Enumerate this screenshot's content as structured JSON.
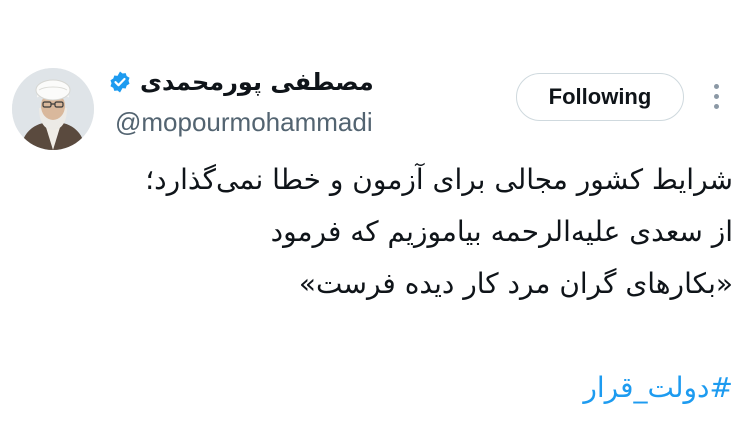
{
  "author": {
    "display_name": "مصطفی پورمحمدی",
    "handle": "@mopourmohammadi",
    "verified": true,
    "verified_icon": "verified-badge-icon",
    "avatar_icon": "profile-photo"
  },
  "actions": {
    "follow_label": "Following",
    "more_icon": "more-vertical-icon"
  },
  "tweet": {
    "lines": [
      "شرایط کشور مجالی برای آزمون و خطا نمی‌گذارد؛",
      "از سعدی علیه‌الرحمه بیاموزیم که فرمود",
      "«بکارهای گران مرد کار دیده فرست»"
    ],
    "hashtag": "#دولت_قرار"
  },
  "colors": {
    "link": "#1d9bf0",
    "text": "#0f1419",
    "secondary": "#536471",
    "verified": "#1d9bf0"
  }
}
